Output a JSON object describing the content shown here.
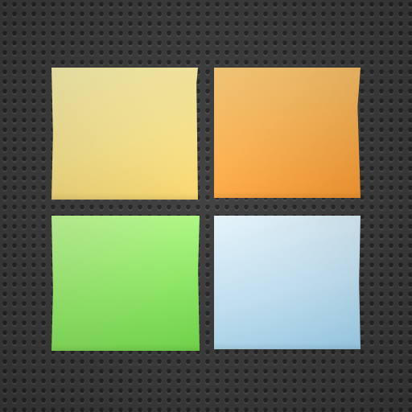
{
  "board": {
    "texture": "dark-dotted-pegboard",
    "background_color": "#3b3b3b"
  },
  "notes": [
    {
      "color_name": "yellow",
      "color": "#fde88f",
      "text": ""
    },
    {
      "color_name": "orange",
      "color": "#ffb34f",
      "text": ""
    },
    {
      "color_name": "green",
      "color": "#98f56c",
      "text": ""
    },
    {
      "color_name": "blue",
      "color": "#cdeeff",
      "text": ""
    }
  ]
}
